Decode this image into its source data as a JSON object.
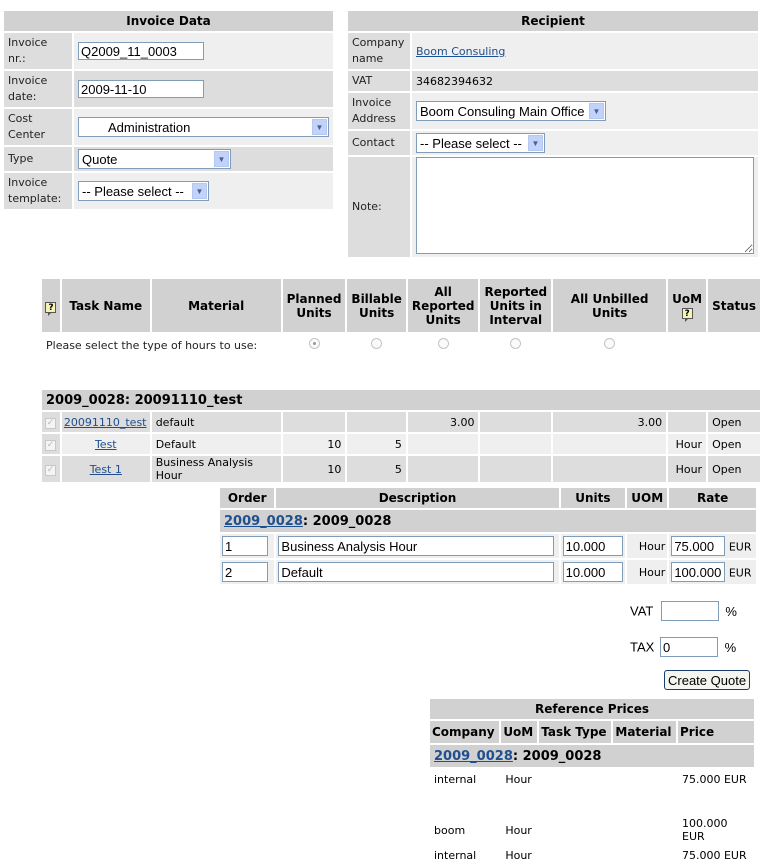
{
  "invoice_data": {
    "title": "Invoice Data",
    "invoice_nr_label": "Invoice nr.:",
    "invoice_nr_value": "Q2009_11_0003",
    "invoice_date_label": "Invoice date:",
    "invoice_date_value": "2009-11-10",
    "cost_center_label": "Cost Center",
    "cost_center_value": "Administration",
    "type_label": "Type",
    "type_value": "Quote",
    "template_label": "Invoice template:",
    "template_value": "-- Please select --"
  },
  "recipient": {
    "title": "Recipient",
    "company_label": "Company name",
    "company_value": "Boom Consuling",
    "vat_label": "VAT",
    "vat_value": "34682394632",
    "address_label": "Invoice Address",
    "address_value": "Boom Consuling Main Office",
    "contact_label": "Contact",
    "contact_value": "-- Please select --",
    "note_label": "Note:",
    "note_value": ""
  },
  "tasks": {
    "headers": {
      "help": "?",
      "task_name": "Task Name",
      "material": "Material",
      "planned": "Planned Units",
      "billable": "Billable Units",
      "all_reported": "All Reported Units",
      "reported_interval": "Reported Units in Interval",
      "all_unbilled": "All Unbilled Units",
      "uom": "UoM",
      "status": "Status"
    },
    "hours_prompt": "Please select the type of hours to use:",
    "hours_selected": "planned",
    "group_title": "2009_0028: 20091110_test",
    "rows": [
      {
        "task": "20091110_test",
        "material": "default",
        "planned": "",
        "billable": "",
        "all_reported": "3.00",
        "reported_interval": "",
        "all_unbilled": "3.00",
        "uom": "",
        "status": "Open"
      },
      {
        "task": "Test",
        "material": "Default",
        "planned": "10",
        "billable": "5",
        "all_reported": "",
        "reported_interval": "",
        "all_unbilled": "",
        "uom": "Hour",
        "status": "Open"
      },
      {
        "task": "Test 1",
        "material": "Business Analysis Hour",
        "planned": "10",
        "billable": "5",
        "all_reported": "",
        "reported_interval": "",
        "all_unbilled": "",
        "uom": "Hour",
        "status": "Open"
      }
    ]
  },
  "lines": {
    "headers": {
      "order": "Order",
      "description": "Description",
      "units": "Units",
      "uom": "UOM",
      "rate": "Rate"
    },
    "group_link": "2009_0028",
    "group_rest": ": 2009_0028",
    "rows": [
      {
        "order": "1",
        "description": "Business Analysis Hour",
        "units": "10.000",
        "uom": "Hour",
        "rate": "75.000",
        "currency": "EUR"
      },
      {
        "order": "2",
        "description": "Default",
        "units": "10.000",
        "uom": "Hour",
        "rate": "100.000",
        "currency": "EUR"
      }
    ],
    "vat_label": "VAT",
    "vat_value": "",
    "tax_label": "TAX",
    "tax_value": "0",
    "percent": "%",
    "create_button": "Create Quote"
  },
  "reference_prices": {
    "title": "Reference Prices",
    "headers": {
      "company": "Company",
      "uom": "UoM",
      "task_type": "Task Type",
      "material": "Material",
      "price": "Price"
    },
    "group_link": "2009_0028",
    "group_rest": ": 2009_0028",
    "rows": [
      {
        "company": "internal",
        "uom": "Hour",
        "task_type": "",
        "material": "",
        "price": "75.000 EUR"
      },
      {
        "company": "boom",
        "uom": "Hour",
        "task_type": "",
        "material": "",
        "price": "100.000 EUR"
      },
      {
        "company": "internal",
        "uom": "Hour",
        "task_type": "",
        "material": "",
        "price": "75.000 EUR"
      }
    ]
  }
}
